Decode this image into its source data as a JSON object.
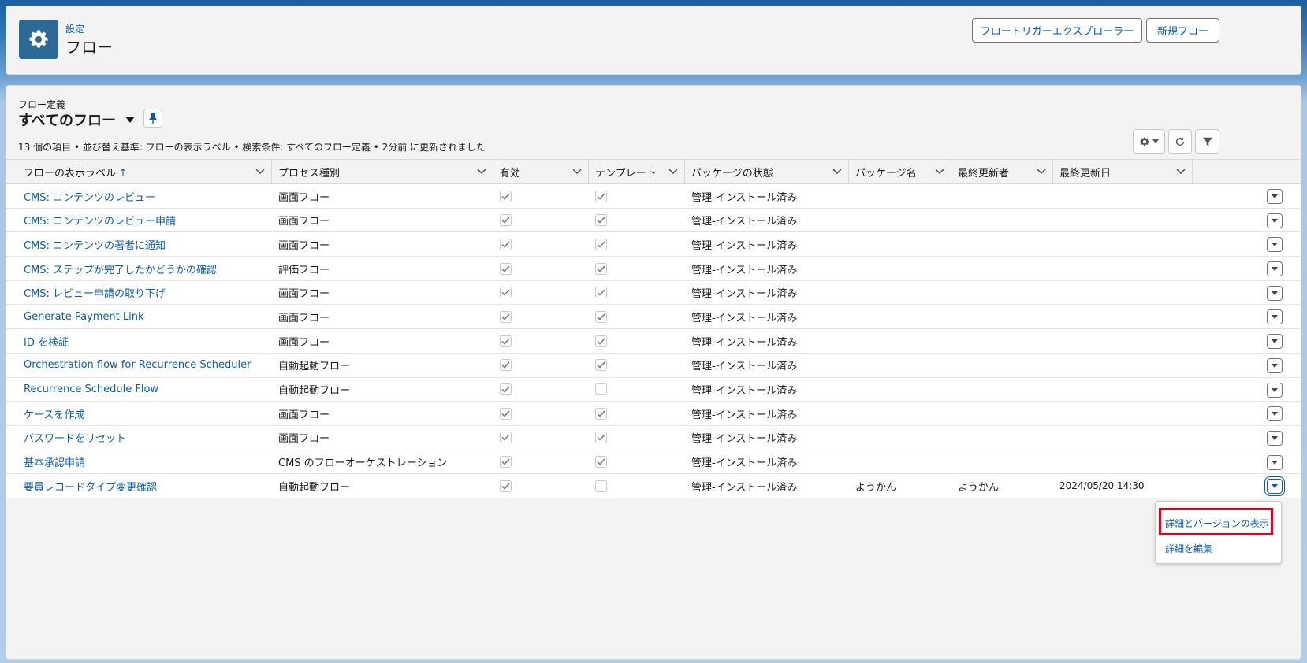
{
  "header": {
    "breadcrumb": "設定",
    "title": "フロー",
    "icon": "gear-icon",
    "buttons": {
      "trigger_explorer": "フロートリガーエクスプローラー",
      "new_flow": "新規フロー"
    }
  },
  "list_view": {
    "subtitle": "フロー定義",
    "title": "すべてのフロー",
    "status": "13 個の項目 • 並び替え基準: フローの表示ラベル • 検索条件: すべてのフロー定義 • 2分前 に更新されました"
  },
  "columns": [
    {
      "label": "フローの表示ラベル",
      "sorted": true
    },
    {
      "label": "プロセス種別"
    },
    {
      "label": "有効"
    },
    {
      "label": "テンプレート"
    },
    {
      "label": "パッケージの状態"
    },
    {
      "label": "パッケージ名"
    },
    {
      "label": "最終更新者"
    },
    {
      "label": "最終更新日"
    }
  ],
  "sort_arrow": "↑",
  "rows": [
    {
      "label": "CMS: コンテンツのレビュー",
      "type": "画面フロー",
      "active": true,
      "template": true,
      "pkg_status": "管理-インストール済み",
      "pkg_name": "",
      "modified_by": "",
      "modified_date": ""
    },
    {
      "label": "CMS: コンテンツのレビュー申請",
      "type": "画面フロー",
      "active": true,
      "template": true,
      "pkg_status": "管理-インストール済み",
      "pkg_name": "",
      "modified_by": "",
      "modified_date": ""
    },
    {
      "label": "CMS: コンテンツの著者に通知",
      "type": "画面フロー",
      "active": true,
      "template": true,
      "pkg_status": "管理-インストール済み",
      "pkg_name": "",
      "modified_by": "",
      "modified_date": ""
    },
    {
      "label": "CMS: ステップが完了したかどうかの確認",
      "type": "評価フロー",
      "active": true,
      "template": true,
      "pkg_status": "管理-インストール済み",
      "pkg_name": "",
      "modified_by": "",
      "modified_date": ""
    },
    {
      "label": "CMS: レビュー申請の取り下げ",
      "type": "画面フロー",
      "active": true,
      "template": true,
      "pkg_status": "管理-インストール済み",
      "pkg_name": "",
      "modified_by": "",
      "modified_date": ""
    },
    {
      "label": "Generate Payment Link",
      "type": "画面フロー",
      "active": true,
      "template": true,
      "pkg_status": "管理-インストール済み",
      "pkg_name": "",
      "modified_by": "",
      "modified_date": ""
    },
    {
      "label": "ID を検証",
      "type": "画面フロー",
      "active": true,
      "template": true,
      "pkg_status": "管理-インストール済み",
      "pkg_name": "",
      "modified_by": "",
      "modified_date": ""
    },
    {
      "label": "Orchestration flow for Recurrence Scheduler",
      "type": "自動起動フロー",
      "active": true,
      "template": true,
      "pkg_status": "管理-インストール済み",
      "pkg_name": "",
      "modified_by": "",
      "modified_date": ""
    },
    {
      "label": "Recurrence Schedule Flow",
      "type": "自動起動フロー",
      "active": true,
      "template": false,
      "pkg_status": "管理-インストール済み",
      "pkg_name": "",
      "modified_by": "",
      "modified_date": ""
    },
    {
      "label": "ケースを作成",
      "type": "画面フロー",
      "active": true,
      "template": true,
      "pkg_status": "管理-インストール済み",
      "pkg_name": "",
      "modified_by": "",
      "modified_date": ""
    },
    {
      "label": "パスワードをリセット",
      "type": "画面フロー",
      "active": true,
      "template": true,
      "pkg_status": "管理-インストール済み",
      "pkg_name": "",
      "modified_by": "",
      "modified_date": ""
    },
    {
      "label": "基本承認申請",
      "type": "CMS のフローオーケストレーション",
      "active": true,
      "template": true,
      "pkg_status": "管理-インストール済み",
      "pkg_name": "",
      "modified_by": "",
      "modified_date": ""
    },
    {
      "label": "要員レコードタイプ変更確認",
      "type": "自動起動フロー",
      "active": true,
      "template": false,
      "pkg_status": "管理-インストール済み",
      "pkg_name": "ようかん",
      "modified_by": "ようかん",
      "modified_date": "2024/05/20 14:30"
    }
  ],
  "row_menu": {
    "view_details": "詳細とバージョンの表示",
    "edit_details": "詳細を編集"
  },
  "colors": {
    "brand": "#0b5cab",
    "icon_bg": "#2b6a97",
    "highlight": "#e3001b"
  }
}
